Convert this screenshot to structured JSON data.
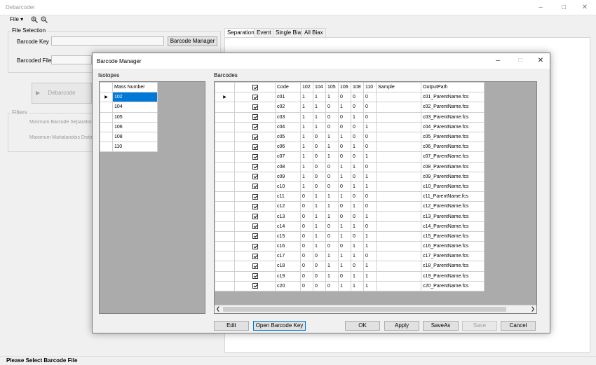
{
  "main": {
    "title": "Debarcoder",
    "menu": {
      "file": "File ▾"
    },
    "file_selection": {
      "group_label": "File Selection",
      "barcode_key_label": "Barcode Key",
      "barcoded_file_label": "Barcoded File",
      "barcode_manager_button": "Barcode Manager"
    },
    "debarcode_button": "Debarcode",
    "filters": {
      "group_label": "Filters",
      "min_separation_label": "Minimum Barcode Separation",
      "max_mahalanobis_label": "Maximum Mahalanobis Distan"
    },
    "tabs": [
      "Separation",
      "Event",
      "Single Biax",
      "All Biax"
    ],
    "active_tab": "Separation",
    "status": "Please Select Barcode File"
  },
  "dialog": {
    "title": "Barcode Manager",
    "isotopes": {
      "group_label": "Isotopes",
      "column": "Mass Number",
      "rows": [
        "102",
        "104",
        "105",
        "106",
        "108",
        "110"
      ],
      "selected": "102"
    },
    "barcodes": {
      "group_label": "Barcodes",
      "columns": [
        "",
        "Code",
        "102",
        "104",
        "105",
        "106",
        "108",
        "110",
        "Sample",
        "OutputPath"
      ],
      "rows": [
        {
          "code": "c01",
          "bits": [
            "1",
            "1",
            "1",
            "0",
            "0",
            "0"
          ],
          "path": "c01_ParentName.fcs"
        },
        {
          "code": "c02",
          "bits": [
            "1",
            "1",
            "0",
            "1",
            "0",
            "0"
          ],
          "path": "c02_ParentName.fcs"
        },
        {
          "code": "c03",
          "bits": [
            "1",
            "1",
            "0",
            "0",
            "1",
            "0"
          ],
          "path": "c03_ParentName.fcs"
        },
        {
          "code": "c04",
          "bits": [
            "1",
            "1",
            "0",
            "0",
            "0",
            "1"
          ],
          "path": "c04_ParentName.fcs"
        },
        {
          "code": "c05",
          "bits": [
            "1",
            "0",
            "1",
            "1",
            "0",
            "0"
          ],
          "path": "c05_ParentName.fcs"
        },
        {
          "code": "c06",
          "bits": [
            "1",
            "0",
            "1",
            "0",
            "1",
            "0"
          ],
          "path": "c06_ParentName.fcs"
        },
        {
          "code": "c07",
          "bits": [
            "1",
            "0",
            "1",
            "0",
            "0",
            "1"
          ],
          "path": "c07_ParentName.fcs"
        },
        {
          "code": "c08",
          "bits": [
            "1",
            "0",
            "0",
            "1",
            "1",
            "0"
          ],
          "path": "c08_ParentName.fcs"
        },
        {
          "code": "c09",
          "bits": [
            "1",
            "0",
            "0",
            "1",
            "0",
            "1"
          ],
          "path": "c09_ParentName.fcs"
        },
        {
          "code": "c10",
          "bits": [
            "1",
            "0",
            "0",
            "0",
            "1",
            "1"
          ],
          "path": "c10_ParentName.fcs"
        },
        {
          "code": "c11",
          "bits": [
            "0",
            "1",
            "1",
            "1",
            "0",
            "0"
          ],
          "path": "c11_ParentName.fcs"
        },
        {
          "code": "c12",
          "bits": [
            "0",
            "1",
            "1",
            "0",
            "1",
            "0"
          ],
          "path": "c12_ParentName.fcs"
        },
        {
          "code": "c13",
          "bits": [
            "0",
            "1",
            "1",
            "0",
            "0",
            "1"
          ],
          "path": "c13_ParentName.fcs"
        },
        {
          "code": "c14",
          "bits": [
            "0",
            "1",
            "0",
            "1",
            "1",
            "0"
          ],
          "path": "c14_ParentName.fcs"
        },
        {
          "code": "c15",
          "bits": [
            "0",
            "1",
            "0",
            "1",
            "0",
            "1"
          ],
          "path": "c15_ParentName.fcs"
        },
        {
          "code": "c16",
          "bits": [
            "0",
            "1",
            "0",
            "0",
            "1",
            "1"
          ],
          "path": "c16_ParentName.fcs"
        },
        {
          "code": "c17",
          "bits": [
            "0",
            "0",
            "1",
            "1",
            "1",
            "0"
          ],
          "path": "c17_ParentName.fcs"
        },
        {
          "code": "c18",
          "bits": [
            "0",
            "0",
            "1",
            "1",
            "0",
            "1"
          ],
          "path": "c18_ParentName.fcs"
        },
        {
          "code": "c19",
          "bits": [
            "0",
            "0",
            "1",
            "0",
            "1",
            "1"
          ],
          "path": "c19_ParentName.fcs"
        },
        {
          "code": "c20",
          "bits": [
            "0",
            "0",
            "0",
            "1",
            "1",
            "1"
          ],
          "path": "c20_ParentName.fcs"
        }
      ]
    },
    "buttons": {
      "edit": "Edit",
      "open_key": "Open Barcode Key",
      "ok": "OK",
      "apply": "Apply",
      "save_as": "SaveAs",
      "save": "Save",
      "cancel": "Cancel"
    }
  }
}
